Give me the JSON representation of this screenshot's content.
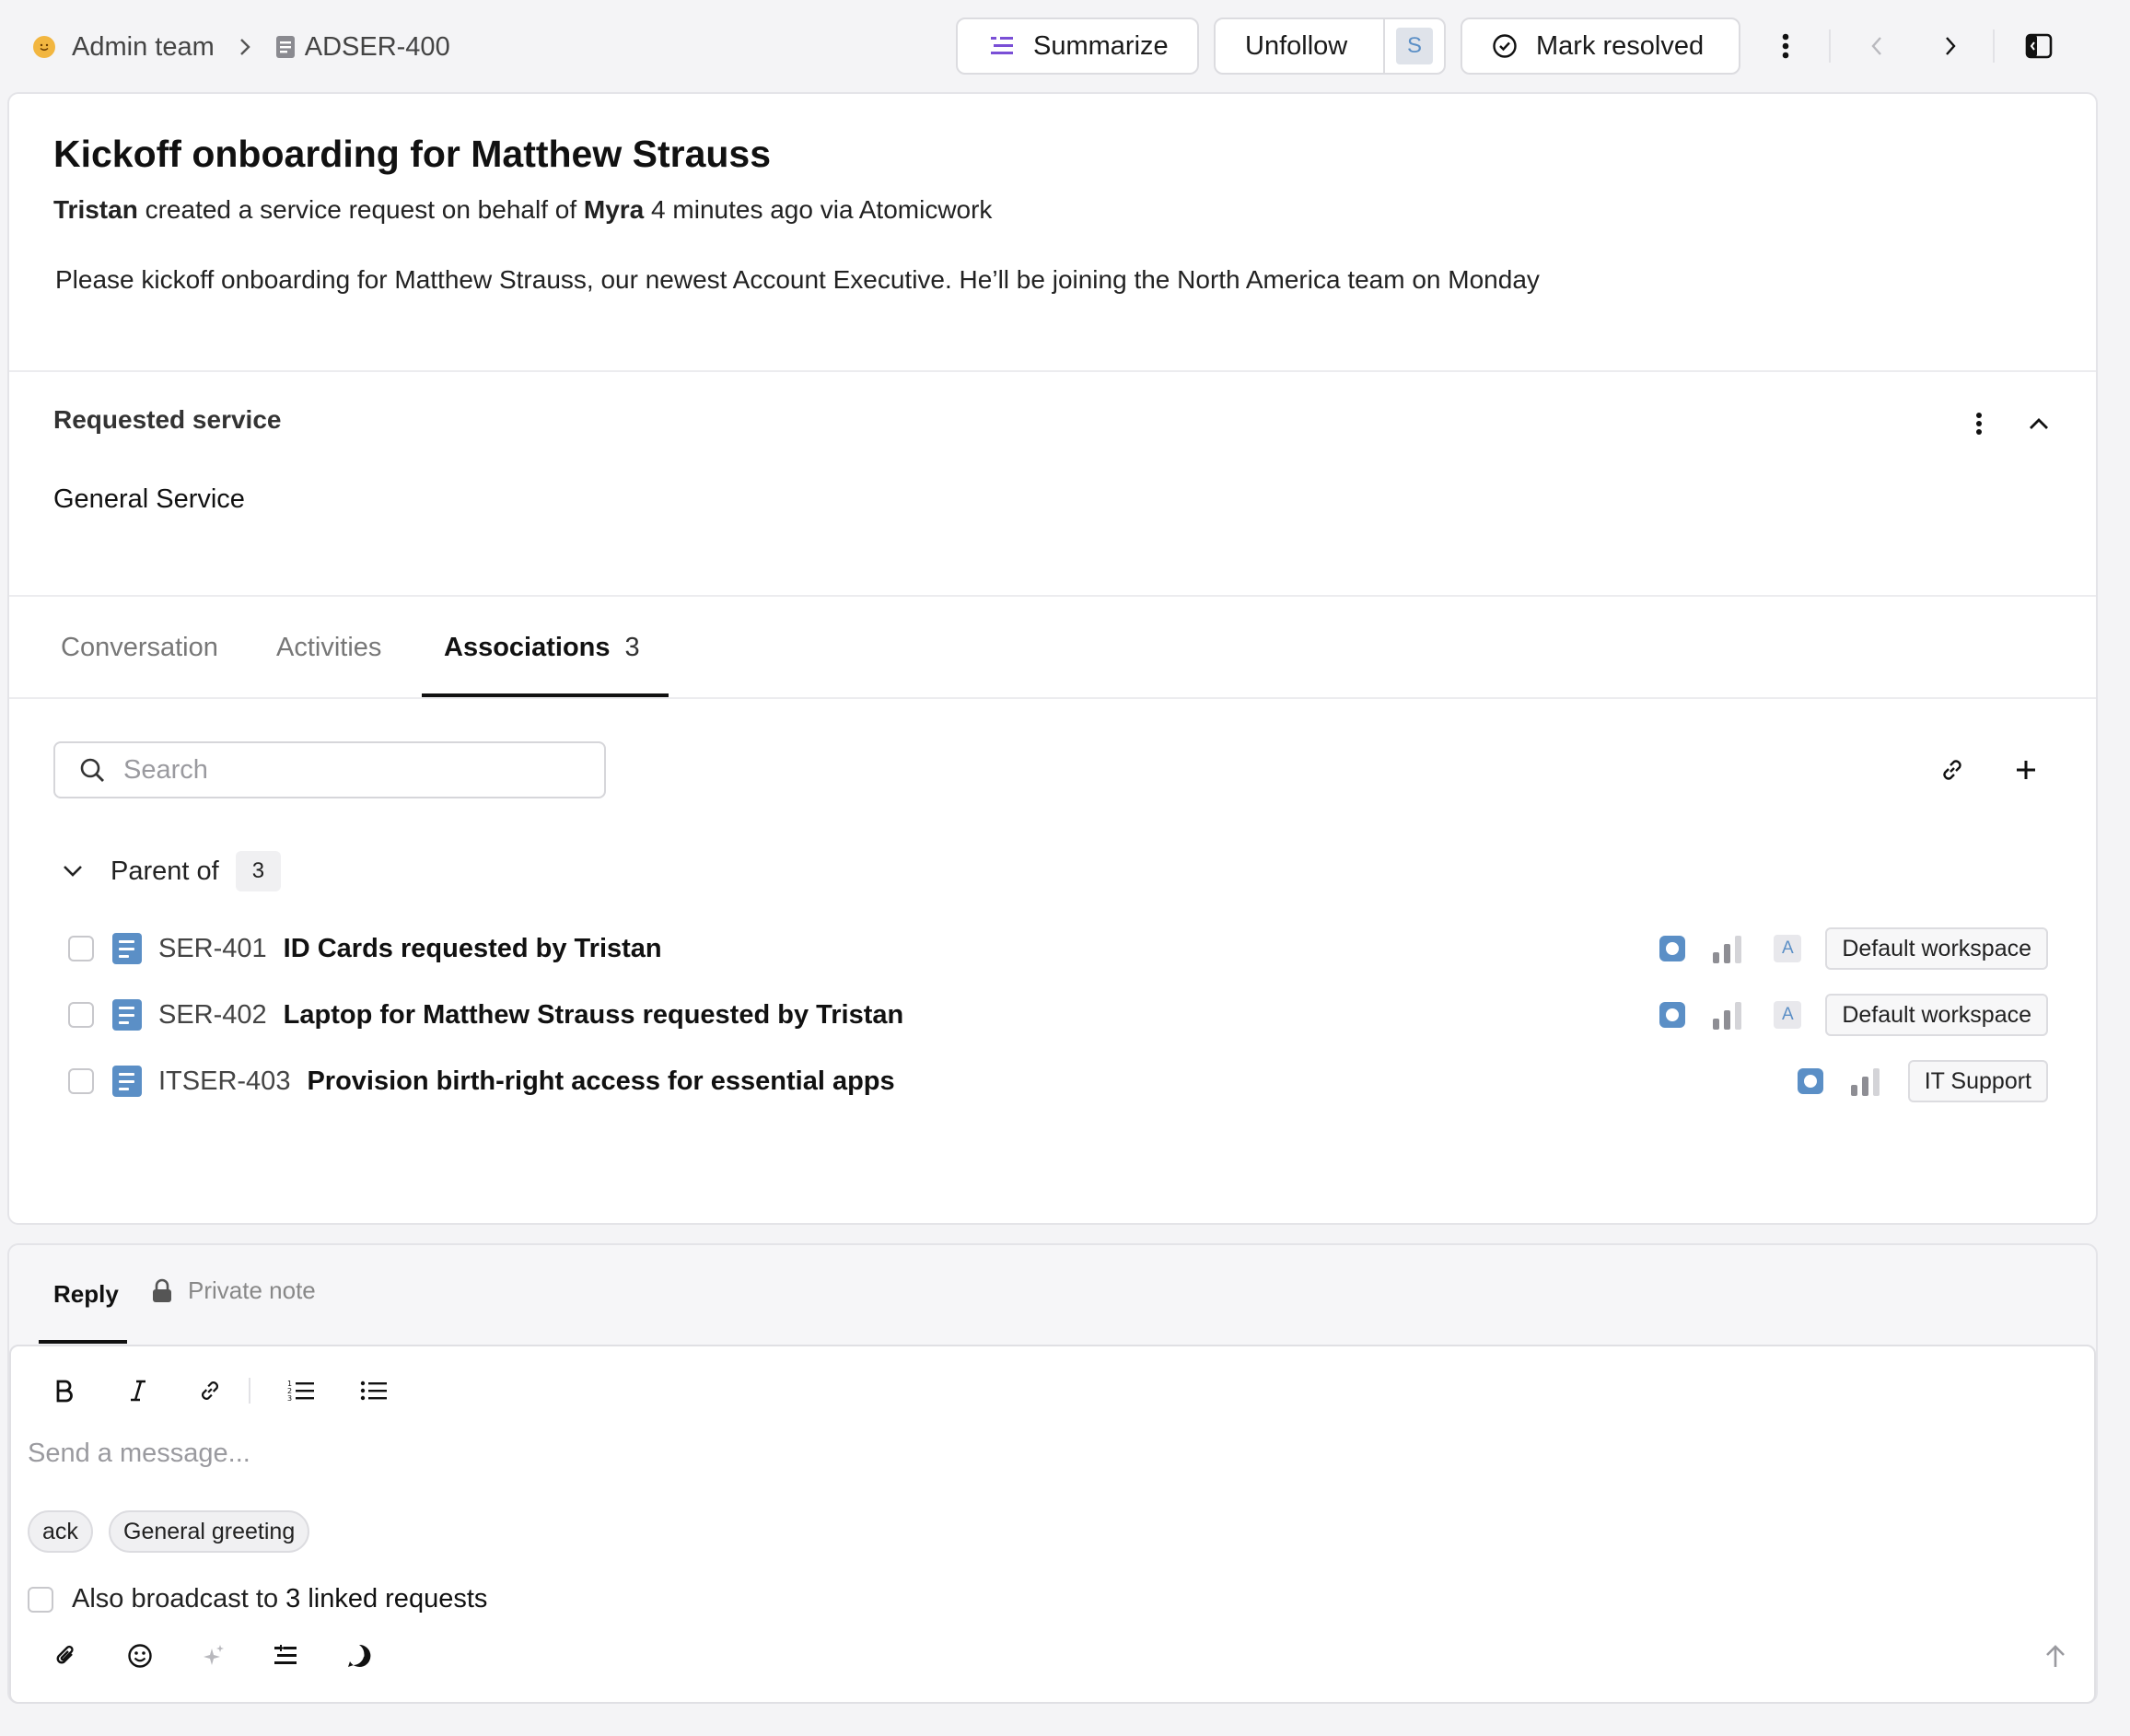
{
  "breadcrumb": {
    "team": "Admin team",
    "ticket_id": "ADSER-400"
  },
  "toolbar": {
    "summarize": "Summarize",
    "unfollow": "Unfollow",
    "follower_initial": "S",
    "mark_resolved": "Mark resolved"
  },
  "ticket": {
    "title": "Kickoff onboarding for Matthew Strauss",
    "creator": "Tristan",
    "action_text": "created a service request on behalf of",
    "on_behalf_of": "Myra",
    "time_ago": "4 minutes ago",
    "via": "via Atomicwork",
    "description": "Please kickoff onboarding for Matthew Strauss, our newest Account Executive. He’ll be joining the North America team on Monday"
  },
  "requested_service": {
    "heading": "Requested service",
    "value": "General Service"
  },
  "tabs": [
    {
      "label": "Conversation",
      "active": false
    },
    {
      "label": "Activities",
      "active": false
    },
    {
      "label": "Associations",
      "count": "3",
      "active": true
    }
  ],
  "associations": {
    "search_placeholder": "Search",
    "group_label": "Parent of",
    "group_count": "3",
    "rows": [
      {
        "id": "SER-401",
        "title": "ID Cards requested by Tristan",
        "assignee": "A",
        "workspace": "Default workspace"
      },
      {
        "id": "SER-402",
        "title": "Laptop for Matthew Strauss requested by Tristan",
        "assignee": "A",
        "workspace": "Default workspace"
      },
      {
        "id": "ITSER-403",
        "title": "Provision birth-right access for essential apps",
        "assignee": "",
        "workspace": "IT Support"
      }
    ]
  },
  "reply": {
    "tab_reply": "Reply",
    "tab_private": "Private note",
    "placeholder": "Send a message...",
    "chips": [
      "ack",
      "General greeting"
    ],
    "broadcast_prefix": "Also broadcast to",
    "broadcast_link": "3 linked requests"
  },
  "colors": {
    "accent_blue": "#5b8fc6",
    "summarize_purple": "#7a4fd6"
  }
}
